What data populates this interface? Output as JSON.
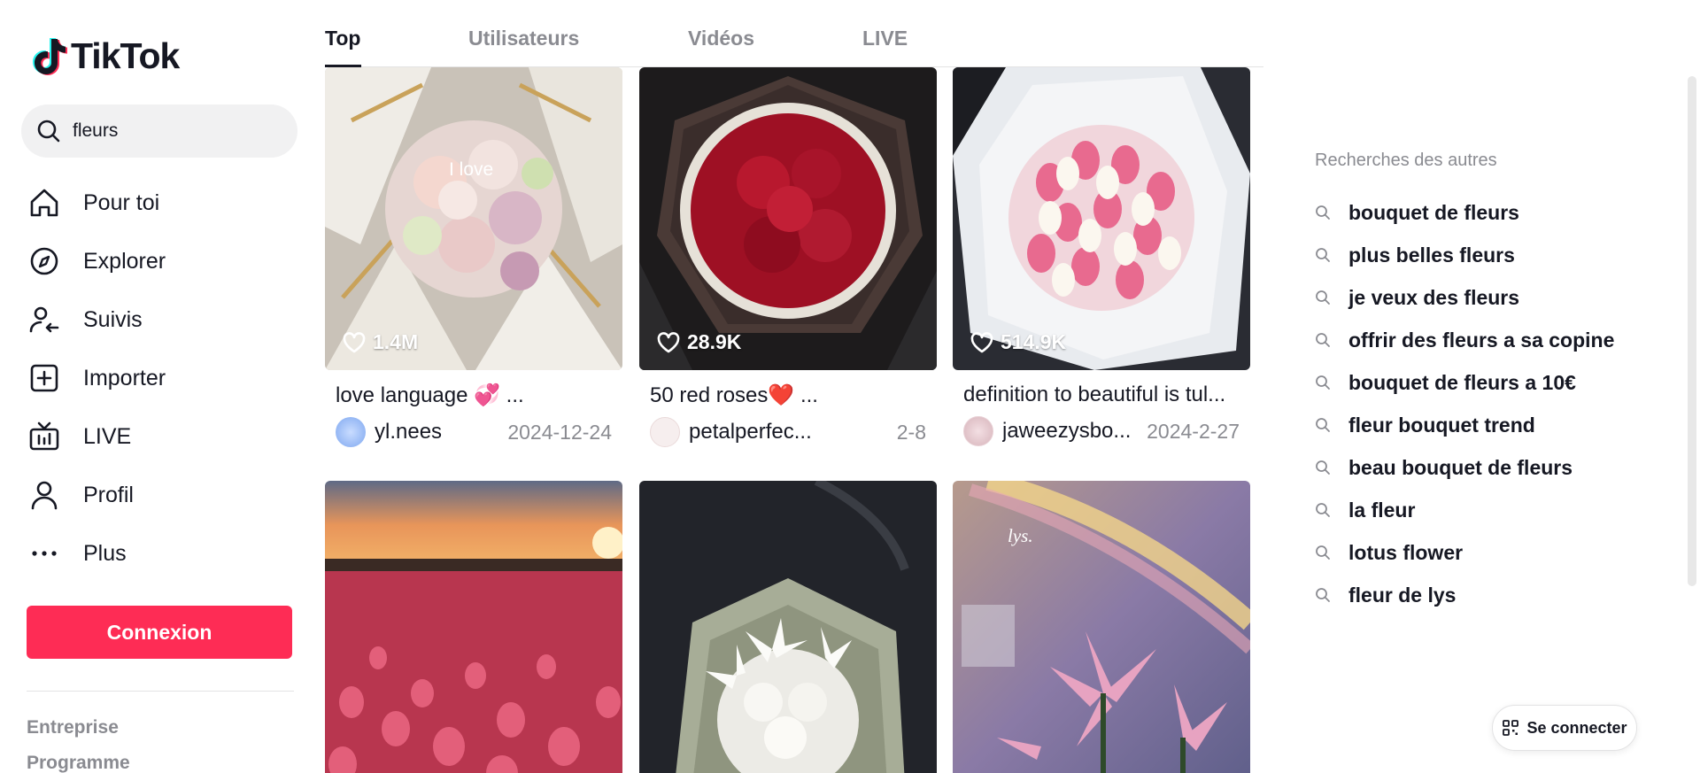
{
  "app": {
    "logo_text": "TikTok"
  },
  "search": {
    "value": "fleurs",
    "icon": "search-icon"
  },
  "nav": {
    "items": [
      {
        "label": "Pour toi",
        "icon": "home-icon"
      },
      {
        "label": "Explorer",
        "icon": "compass-icon"
      },
      {
        "label": "Suivis",
        "icon": "following-icon"
      },
      {
        "label": "Importer",
        "icon": "upload-icon"
      },
      {
        "label": "LIVE",
        "icon": "live-tv-icon"
      },
      {
        "label": "Profil",
        "icon": "profile-icon"
      },
      {
        "label": "Plus",
        "icon": "more-icon"
      }
    ]
  },
  "login": {
    "label": "Connexion"
  },
  "footer": {
    "links": [
      "Entreprise",
      "Programme"
    ]
  },
  "tabs": [
    {
      "label": "Top",
      "active": true
    },
    {
      "label": "Utilisateurs",
      "active": false
    },
    {
      "label": "Vidéos",
      "active": false
    },
    {
      "label": "LIVE",
      "active": false
    }
  ],
  "videos": [
    {
      "likes": "1.4M",
      "overlay": "I love",
      "description": "love language 💞 ...",
      "username": "yl.nees",
      "date": "2024-12-24"
    },
    {
      "likes": "28.9K",
      "overlay": "",
      "description": "50 red roses❤️ ...",
      "username": "petalperfec...",
      "date": "2-8"
    },
    {
      "likes": "514.9K",
      "overlay": "",
      "description": "definition to beautiful is tul...",
      "username": "jaweezysbo...",
      "date": "2024-2-27"
    },
    {
      "likes": "",
      "overlay": "",
      "description": "",
      "username": "",
      "date": ""
    },
    {
      "likes": "",
      "overlay": "",
      "description": "",
      "username": "",
      "date": ""
    },
    {
      "likes": "",
      "overlay": "lys.",
      "description": "",
      "username": "",
      "date": ""
    }
  ],
  "related": {
    "title": "Recherches des autres",
    "items": [
      "bouquet de fleurs",
      "plus belles fleurs",
      "je veux des fleurs",
      "offrir des fleurs a sa copine",
      "bouquet de fleurs a 10€",
      "fleur bouquet trend",
      "beau bouquet de fleurs",
      "la fleur",
      "lotus flower",
      "fleur de lys"
    ]
  },
  "qr_login": {
    "label": "Se connecter",
    "icon": "qr-code-icon"
  },
  "colors": {
    "accent": "#fe2c55",
    "text": "#161823",
    "muted": "#8a8b91"
  }
}
